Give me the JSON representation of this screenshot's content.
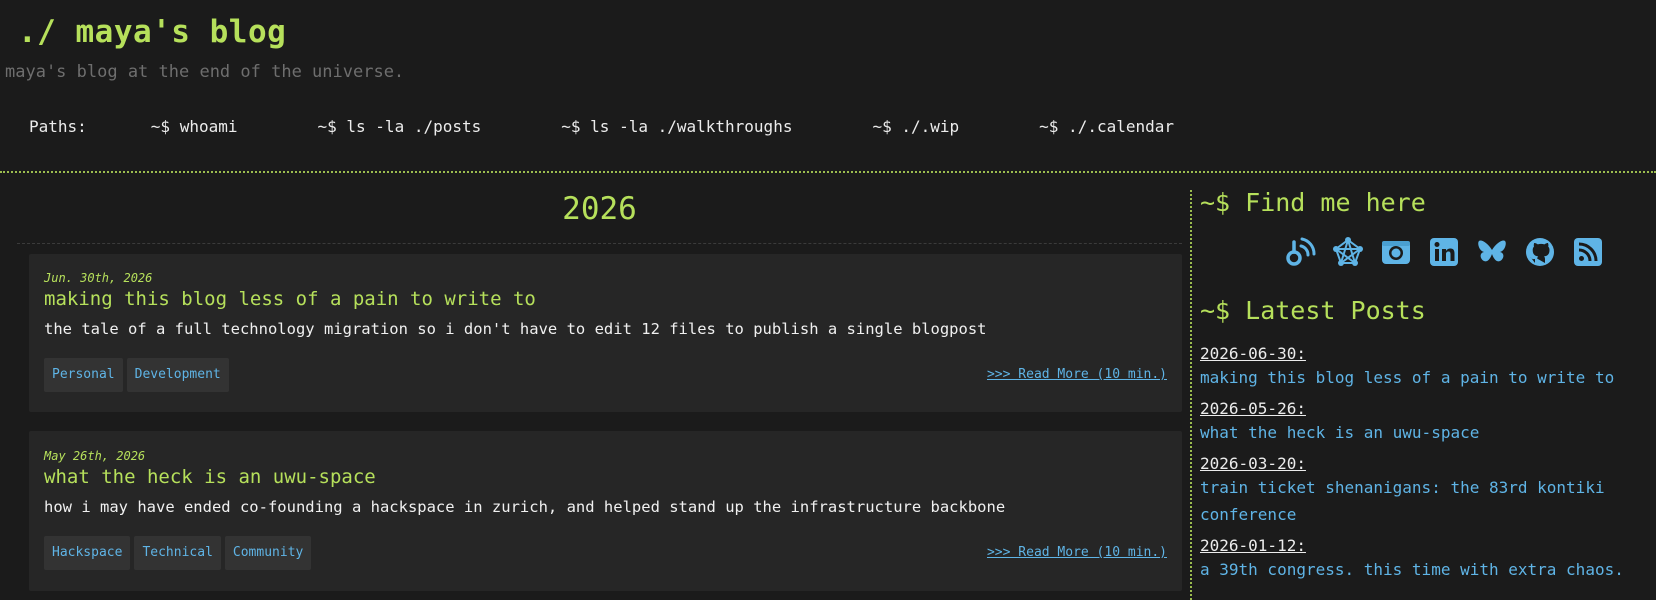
{
  "site": {
    "logo": "./ maya's blog",
    "tagline": "maya's blog at the end of the universe."
  },
  "nav": {
    "label": "Paths:",
    "items": [
      {
        "label": "~$ whoami"
      },
      {
        "label": "~$ ls -la ./posts"
      },
      {
        "label": "~$ ls -la ./walkthroughs"
      },
      {
        "label": "~$ ./.wip"
      },
      {
        "label": "~$ ./.calendar"
      }
    ]
  },
  "main": {
    "year": "2026",
    "posts": [
      {
        "date": "Jun. 30th, 2026",
        "title": "making this blog less of a pain to write to",
        "summary": "the tale of a full technology migration so i don't have to edit 12 files to publish a single blogpost",
        "tags": [
          "Personal",
          "Development"
        ],
        "read_more": ">>> Read More (10 min.)"
      },
      {
        "date": "May 26th, 2026",
        "title": "what the heck is an uwu-space",
        "summary": "how i may have ended co-founding a hackspace in zurich, and helped stand up the infrastructure backbone",
        "tags": [
          "Hackspace",
          "Technical",
          "Community"
        ],
        "read_more": ">>> Read More (10 min.)"
      }
    ]
  },
  "sidebar": {
    "find_heading": "~$ Find me here",
    "socials": [
      {
        "icon": "blog-feed-icon"
      },
      {
        "icon": "fediverse-icon"
      },
      {
        "icon": "instagram-icon"
      },
      {
        "icon": "linkedin-icon"
      },
      {
        "icon": "bluesky-icon"
      },
      {
        "icon": "github-icon"
      },
      {
        "icon": "rss-icon"
      }
    ],
    "latest_heading": "~$ Latest Posts",
    "latest": [
      {
        "date": "2026-06-30:",
        "title": "making this blog less of a pain to write to"
      },
      {
        "date": "2026-05-26:",
        "title": "what the heck is an uwu-space"
      },
      {
        "date": "2026-03-20:",
        "title": "train ticket shenanigans: the 83rd kontiki conference"
      },
      {
        "date": "2026-01-12:",
        "title": "a 39th congress. this time with extra chaos."
      }
    ]
  },
  "colors": {
    "background": "#1b1b1b",
    "accent_green": "#b6e05b",
    "link_blue": "#5fb4e6",
    "card": "#262626"
  }
}
